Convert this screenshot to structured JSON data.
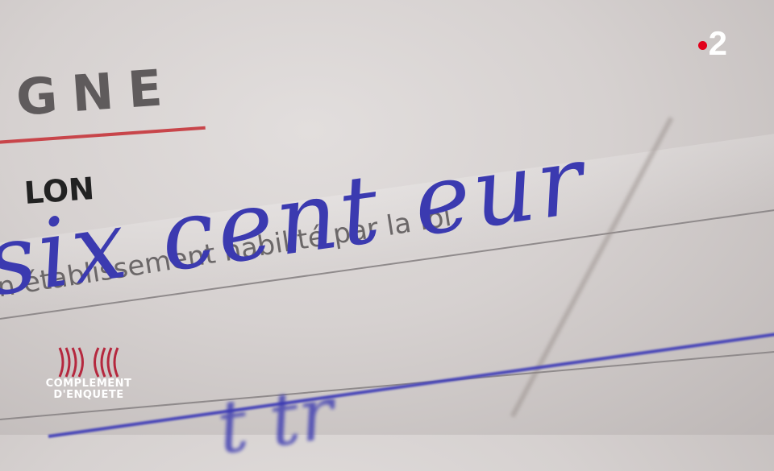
{
  "document": {
    "header_word": "GNE",
    "label": "LON",
    "printed_line": "n établissement habilité par la loi",
    "handwriting_line1": "six cent eur",
    "handwriting_line2": "t  tr"
  },
  "overlay": {
    "channel_logo": "2",
    "show_logo_line1": "COMPLEMENT",
    "show_logo_line2": "D'ENQUETE"
  },
  "colors": {
    "ink": "#3b3ab0",
    "channel_red": "#e2001a",
    "logo_red": "#b5283e"
  }
}
